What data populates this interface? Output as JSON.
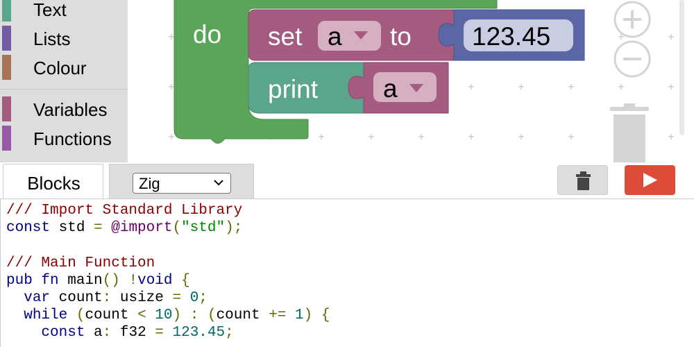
{
  "colors": {
    "toolbox_bg": "#dddddd",
    "text_category": "#5ba58c",
    "lists_category": "#745ba5",
    "colour_category": "#a5745b",
    "variables_category": "#a55b80",
    "functions_category": "#995ba5",
    "loop_block": "#5ba55b",
    "set_block": "#a55b80",
    "print_block": "#5ba58c",
    "number_block": "#5b67a5",
    "run_button": "#dd4b39"
  },
  "toolbox": {
    "categories": [
      {
        "label": "Text",
        "color": "#5ba58c"
      },
      {
        "label": "Lists",
        "color": "#745ba5"
      },
      {
        "label": "Colour",
        "color": "#a5745b"
      },
      {
        "label": "Variables",
        "color": "#a55b80"
      },
      {
        "label": "Functions",
        "color": "#995ba5"
      }
    ]
  },
  "workspace": {
    "loop_block": {
      "do_label": "do"
    },
    "set_block": {
      "set_label": "set",
      "variable": "a",
      "to_label": "to"
    },
    "number_block": {
      "value": "123.45"
    },
    "print_block": {
      "print_label": "print",
      "variable": "a"
    },
    "icons": [
      "zoom-in-icon",
      "zoom-out-icon",
      "trashcan-icon"
    ]
  },
  "tabs": {
    "blocks_label": "Blocks",
    "language_selected": "Zig"
  },
  "toolbar": {
    "trash_icon": "trash-icon",
    "run_icon": "play-icon"
  },
  "code": {
    "lines": [
      [
        {
          "t": "/// Import Standard Library",
          "c": "comment"
        }
      ],
      [
        {
          "t": "const",
          "c": "keyword"
        },
        {
          "t": " std ",
          "c": "plain"
        },
        {
          "t": "=",
          "c": "punct"
        },
        {
          "t": " @import",
          "c": "type"
        },
        {
          "t": "(",
          "c": "punct"
        },
        {
          "t": "\"std\"",
          "c": "string"
        },
        {
          "t": ");",
          "c": "punct"
        }
      ],
      [
        {
          "t": " ",
          "c": "plain"
        }
      ],
      [
        {
          "t": "/// Main Function",
          "c": "comment"
        }
      ],
      [
        {
          "t": "pub",
          "c": "keyword"
        },
        {
          "t": " ",
          "c": "plain"
        },
        {
          "t": "fn",
          "c": "keyword"
        },
        {
          "t": " main",
          "c": "plain"
        },
        {
          "t": "()",
          "c": "punct"
        },
        {
          "t": " ",
          "c": "plain"
        },
        {
          "t": "!",
          "c": "punct"
        },
        {
          "t": "void",
          "c": "keyword"
        },
        {
          "t": " ",
          "c": "plain"
        },
        {
          "t": "{",
          "c": "punct"
        }
      ],
      [
        {
          "t": "  ",
          "c": "plain"
        },
        {
          "t": "var",
          "c": "keyword"
        },
        {
          "t": " count",
          "c": "plain"
        },
        {
          "t": ":",
          "c": "punct"
        },
        {
          "t": " usize ",
          "c": "plain"
        },
        {
          "t": "=",
          "c": "punct"
        },
        {
          "t": " ",
          "c": "plain"
        },
        {
          "t": "0",
          "c": "number"
        },
        {
          "t": ";",
          "c": "punct"
        }
      ],
      [
        {
          "t": "  ",
          "c": "plain"
        },
        {
          "t": "while",
          "c": "keyword"
        },
        {
          "t": " ",
          "c": "plain"
        },
        {
          "t": "(",
          "c": "punct"
        },
        {
          "t": "count ",
          "c": "plain"
        },
        {
          "t": "<",
          "c": "punct"
        },
        {
          "t": " ",
          "c": "plain"
        },
        {
          "t": "10",
          "c": "number"
        },
        {
          "t": ")",
          "c": "punct"
        },
        {
          "t": " ",
          "c": "plain"
        },
        {
          "t": ":",
          "c": "punct"
        },
        {
          "t": " ",
          "c": "plain"
        },
        {
          "t": "(",
          "c": "punct"
        },
        {
          "t": "count ",
          "c": "plain"
        },
        {
          "t": "+=",
          "c": "punct"
        },
        {
          "t": " ",
          "c": "plain"
        },
        {
          "t": "1",
          "c": "number"
        },
        {
          "t": ")",
          "c": "punct"
        },
        {
          "t": " ",
          "c": "plain"
        },
        {
          "t": "{",
          "c": "punct"
        }
      ],
      [
        {
          "t": "    ",
          "c": "plain"
        },
        {
          "t": "const",
          "c": "keyword"
        },
        {
          "t": " a",
          "c": "plain"
        },
        {
          "t": ":",
          "c": "punct"
        },
        {
          "t": " f32 ",
          "c": "plain"
        },
        {
          "t": "=",
          "c": "punct"
        },
        {
          "t": " ",
          "c": "plain"
        },
        {
          "t": "123.45",
          "c": "number"
        },
        {
          "t": ";",
          "c": "punct"
        }
      ]
    ]
  }
}
